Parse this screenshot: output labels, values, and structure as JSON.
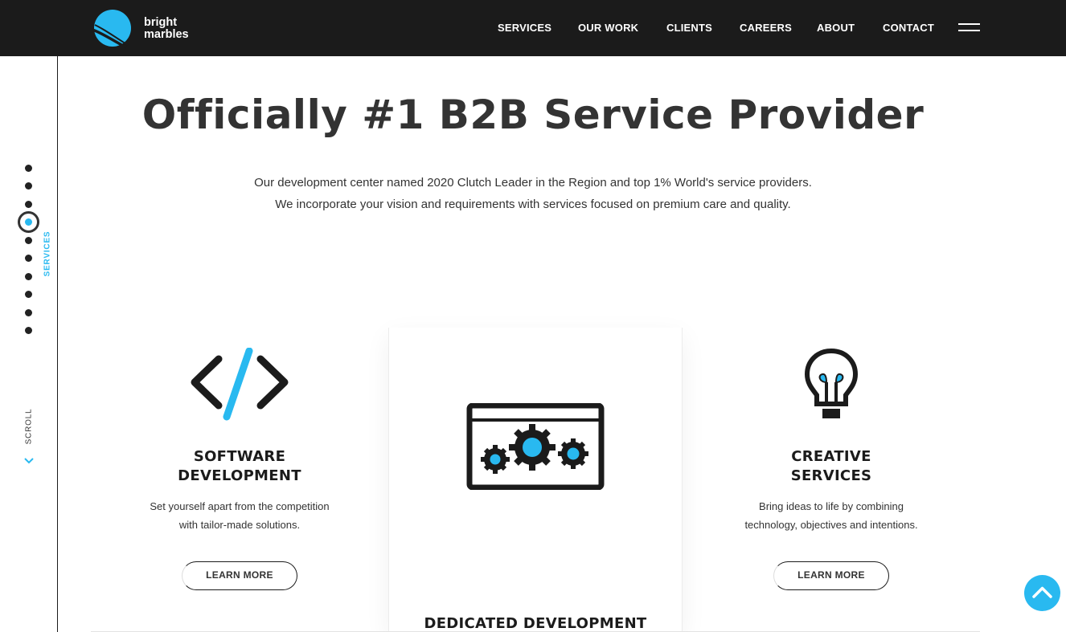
{
  "brand": {
    "line1": "bright",
    "line2": "marbles",
    "accent_color": "#29b9f0",
    "header_bg": "#1b1b1b"
  },
  "nav": {
    "items": [
      "SERVICES",
      "OUR WORK",
      "CLIENTS",
      "CAREERS",
      "ABOUT",
      "CONTACT"
    ],
    "menu_icon": "hamburger-icon"
  },
  "sidebar": {
    "section_label": "SERVICES",
    "scroll_label": "SCROLL",
    "active_dot_index": 3,
    "dot_count": 10
  },
  "hero": {
    "title": "Officially #1 B2B Service Provider",
    "line1": "Our development center named 2020 Clutch Leader in the Region and top 1% World's service providers.",
    "line2": "We incorporate your vision and requirements with services focused on premium care and quality."
  },
  "services": [
    {
      "icon": "code-icon",
      "title_line1": "SOFTWARE",
      "title_line2": "DEVELOPMENT",
      "text_line1": "Set yourself apart from the competition",
      "text_line2": "with tailor-made solutions.",
      "button": "LEARN MORE"
    },
    {
      "icon": "gears-window-icon",
      "title": "DEDICATED DEVELOPMENT"
    },
    {
      "icon": "lightbulb-icon",
      "title_line1": "CREATIVE",
      "title_line2": "SERVICES",
      "text_line1": "Bring ideas to life by combining",
      "text_line2": "technology, objectives and intentions.",
      "button": "LEARN MORE"
    }
  ],
  "back_to_top_icon": "chevron-up-icon"
}
